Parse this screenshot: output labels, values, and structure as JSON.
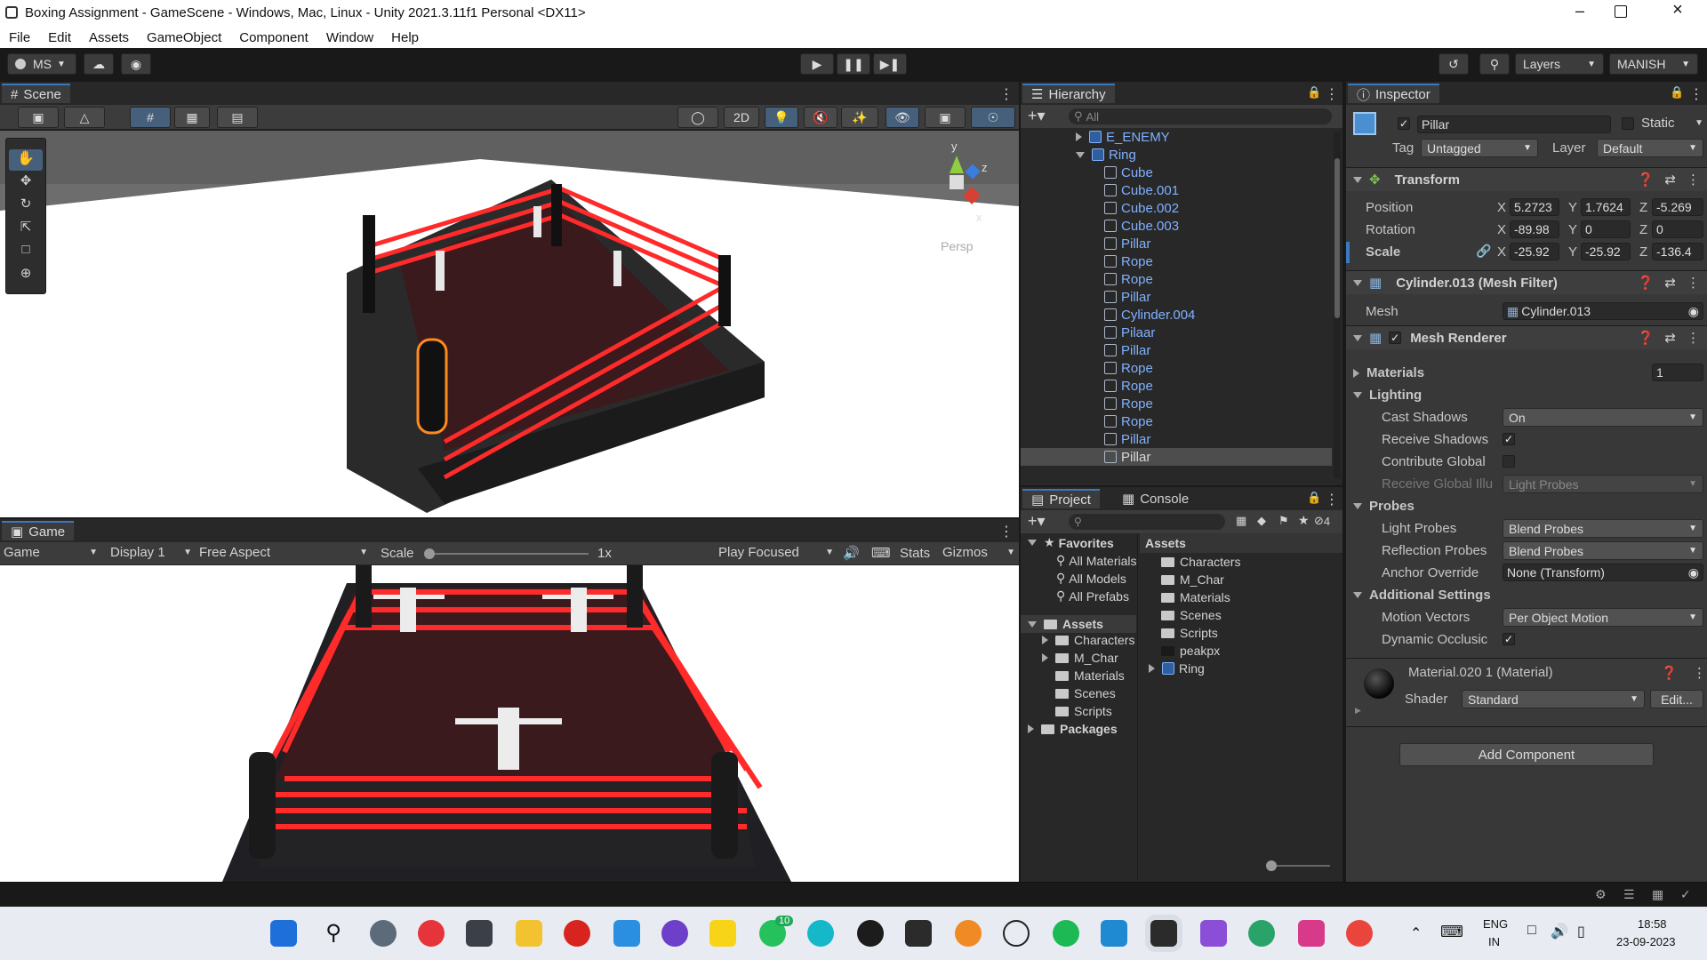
{
  "window": {
    "title": "Boxing Assignment - GameScene - Windows, Mac, Linux - Unity 2021.3.11f1 Personal <DX11>"
  },
  "menu": [
    "File",
    "Edit",
    "Assets",
    "GameObject",
    "Component",
    "Window",
    "Help"
  ],
  "toolbar": {
    "account": "MS",
    "layers": "Layers",
    "layout": "MANISH"
  },
  "scene": {
    "tab": "Scene",
    "mode2d": "2D",
    "persp": "Persp",
    "axis_y": "y",
    "axis_z": "z",
    "axis_x": "x"
  },
  "game": {
    "tab": "Game",
    "display_mode": "Game",
    "display": "Display 1",
    "aspect": "Free Aspect",
    "scale_label": "Scale",
    "scale_value": "1x",
    "play_mode": "Play Focused",
    "stats": "Stats",
    "gizmos": "Gizmos"
  },
  "hierarchy": {
    "tab": "Hierarchy",
    "search_placeholder": "All",
    "items": [
      {
        "label": "E_ENEMY",
        "indent": 0,
        "folded": true,
        "prefab": true
      },
      {
        "label": "Ring",
        "indent": 0,
        "folded": false,
        "prefab": true
      },
      {
        "label": "Cube",
        "indent": 1
      },
      {
        "label": "Cube.001",
        "indent": 1
      },
      {
        "label": "Cube.002",
        "indent": 1
      },
      {
        "label": "Cube.003",
        "indent": 1
      },
      {
        "label": "Pillar",
        "indent": 1
      },
      {
        "label": "Rope",
        "indent": 1
      },
      {
        "label": "Rope",
        "indent": 1
      },
      {
        "label": "Pillar",
        "indent": 1
      },
      {
        "label": "Cylinder.004",
        "indent": 1
      },
      {
        "label": "Pilaar",
        "indent": 1
      },
      {
        "label": "Pillar",
        "indent": 1
      },
      {
        "label": "Rope",
        "indent": 1
      },
      {
        "label": "Rope",
        "indent": 1
      },
      {
        "label": "Rope",
        "indent": 1
      },
      {
        "label": "Rope",
        "indent": 1
      },
      {
        "label": "Pillar",
        "indent": 1
      },
      {
        "label": "Pillar",
        "indent": 1,
        "selected": true
      }
    ]
  },
  "project": {
    "tab_project": "Project",
    "tab_console": "Console",
    "hidden_count": "4",
    "favorites_label": "Favorites",
    "favorites": [
      "All Materials",
      "All Models",
      "All Prefabs"
    ],
    "assets_label": "Assets",
    "tree": [
      "Characters",
      "M_Char",
      "Materials",
      "Scenes",
      "Scripts"
    ],
    "packages_label": "Packages",
    "breadcrumb": "Assets",
    "files": [
      {
        "label": "Characters",
        "kind": "folder"
      },
      {
        "label": "M_Char",
        "kind": "folder"
      },
      {
        "label": "Materials",
        "kind": "folder"
      },
      {
        "label": "Scenes",
        "kind": "folder"
      },
      {
        "label": "Scripts",
        "kind": "folder"
      },
      {
        "label": "peakpx",
        "kind": "image"
      },
      {
        "label": "Ring",
        "kind": "prefab"
      }
    ]
  },
  "inspector": {
    "tab": "Inspector",
    "object_name": "Pillar",
    "static_label": "Static",
    "tag_label": "Tag",
    "tag_value": "Untagged",
    "layer_label": "Layer",
    "layer_value": "Default",
    "transform": {
      "title": "Transform",
      "position_label": "Position",
      "position": {
        "x": "5.2723",
        "y": "1.7624",
        "z": "-5.269"
      },
      "rotation_label": "Rotation",
      "rotation": {
        "x": "-89.98",
        "y": "0",
        "z": "0"
      },
      "scale_label": "Scale",
      "scale": {
        "x": "-25.92",
        "y": "-25.92",
        "z": "-136.4"
      }
    },
    "mesh_filter": {
      "title": "Cylinder.013 (Mesh Filter)",
      "mesh_label": "Mesh",
      "mesh_value": "Cylinder.013"
    },
    "mesh_renderer": {
      "title": "Mesh Renderer",
      "materials_label": "Materials",
      "materials_count": "1",
      "lighting_label": "Lighting",
      "cast_shadows_label": "Cast Shadows",
      "cast_shadows_value": "On",
      "receive_shadows_label": "Receive Shadows",
      "contribute_global_label": "Contribute Global",
      "receive_gi_label": "Receive Global Illu",
      "receive_gi_value": "Light Probes",
      "probes_label": "Probes",
      "light_probes_label": "Light Probes",
      "light_probes_value": "Blend Probes",
      "reflection_probes_label": "Reflection Probes",
      "reflection_probes_value": "Blend Probes",
      "anchor_override_label": "Anchor Override",
      "anchor_override_value": "None (Transform)",
      "additional_label": "Additional Settings",
      "motion_vectors_label": "Motion Vectors",
      "motion_vectors_value": "Per Object Motion",
      "dynamic_occlusion_label": "Dynamic Occlusic"
    },
    "material": {
      "title": "Material.020 1 (Material)",
      "shader_label": "Shader",
      "shader_value": "Standard",
      "edit_label": "Edit..."
    },
    "add_component": "Add Component"
  },
  "taskbar": {
    "lang_top": "ENG",
    "lang_bottom": "IN",
    "time": "18:58",
    "date": "23-09-2023",
    "whatsapp_badge": "10"
  },
  "colors": {
    "accent": "#3a79bb",
    "rope_red": "#ff2a2a",
    "hier_blue": "#7fb1ff"
  }
}
